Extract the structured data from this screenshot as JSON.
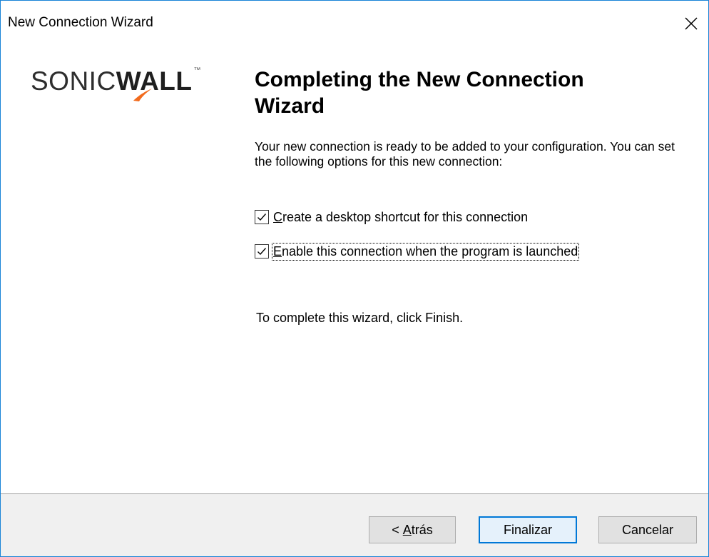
{
  "window": {
    "title": "New Connection Wizard"
  },
  "logo": {
    "text_light": "SONIC",
    "text_bold": "WALL",
    "tm": "™"
  },
  "content": {
    "heading": "Completing the New Connection Wizard",
    "description": "Your new connection is ready to be added to your configuration. You can set the following options for this new connection:",
    "options": [
      {
        "label_first": "C",
        "label_rest": "reate a desktop shortcut for this connection",
        "checked": true
      },
      {
        "label_first": "E",
        "label_rest": "nable this connection when the program is launched",
        "checked": true
      }
    ],
    "finish_hint": "To complete this wizard, click Finish."
  },
  "buttons": {
    "back_prefix": "< ",
    "back_underlined": "A",
    "back_rest": "trás",
    "finish": "Finalizar",
    "cancel": "Cancelar"
  },
  "colors": {
    "accent": "#0078d7",
    "logo_orange": "#f26b1d",
    "footer_bg": "#f0f0f0"
  }
}
